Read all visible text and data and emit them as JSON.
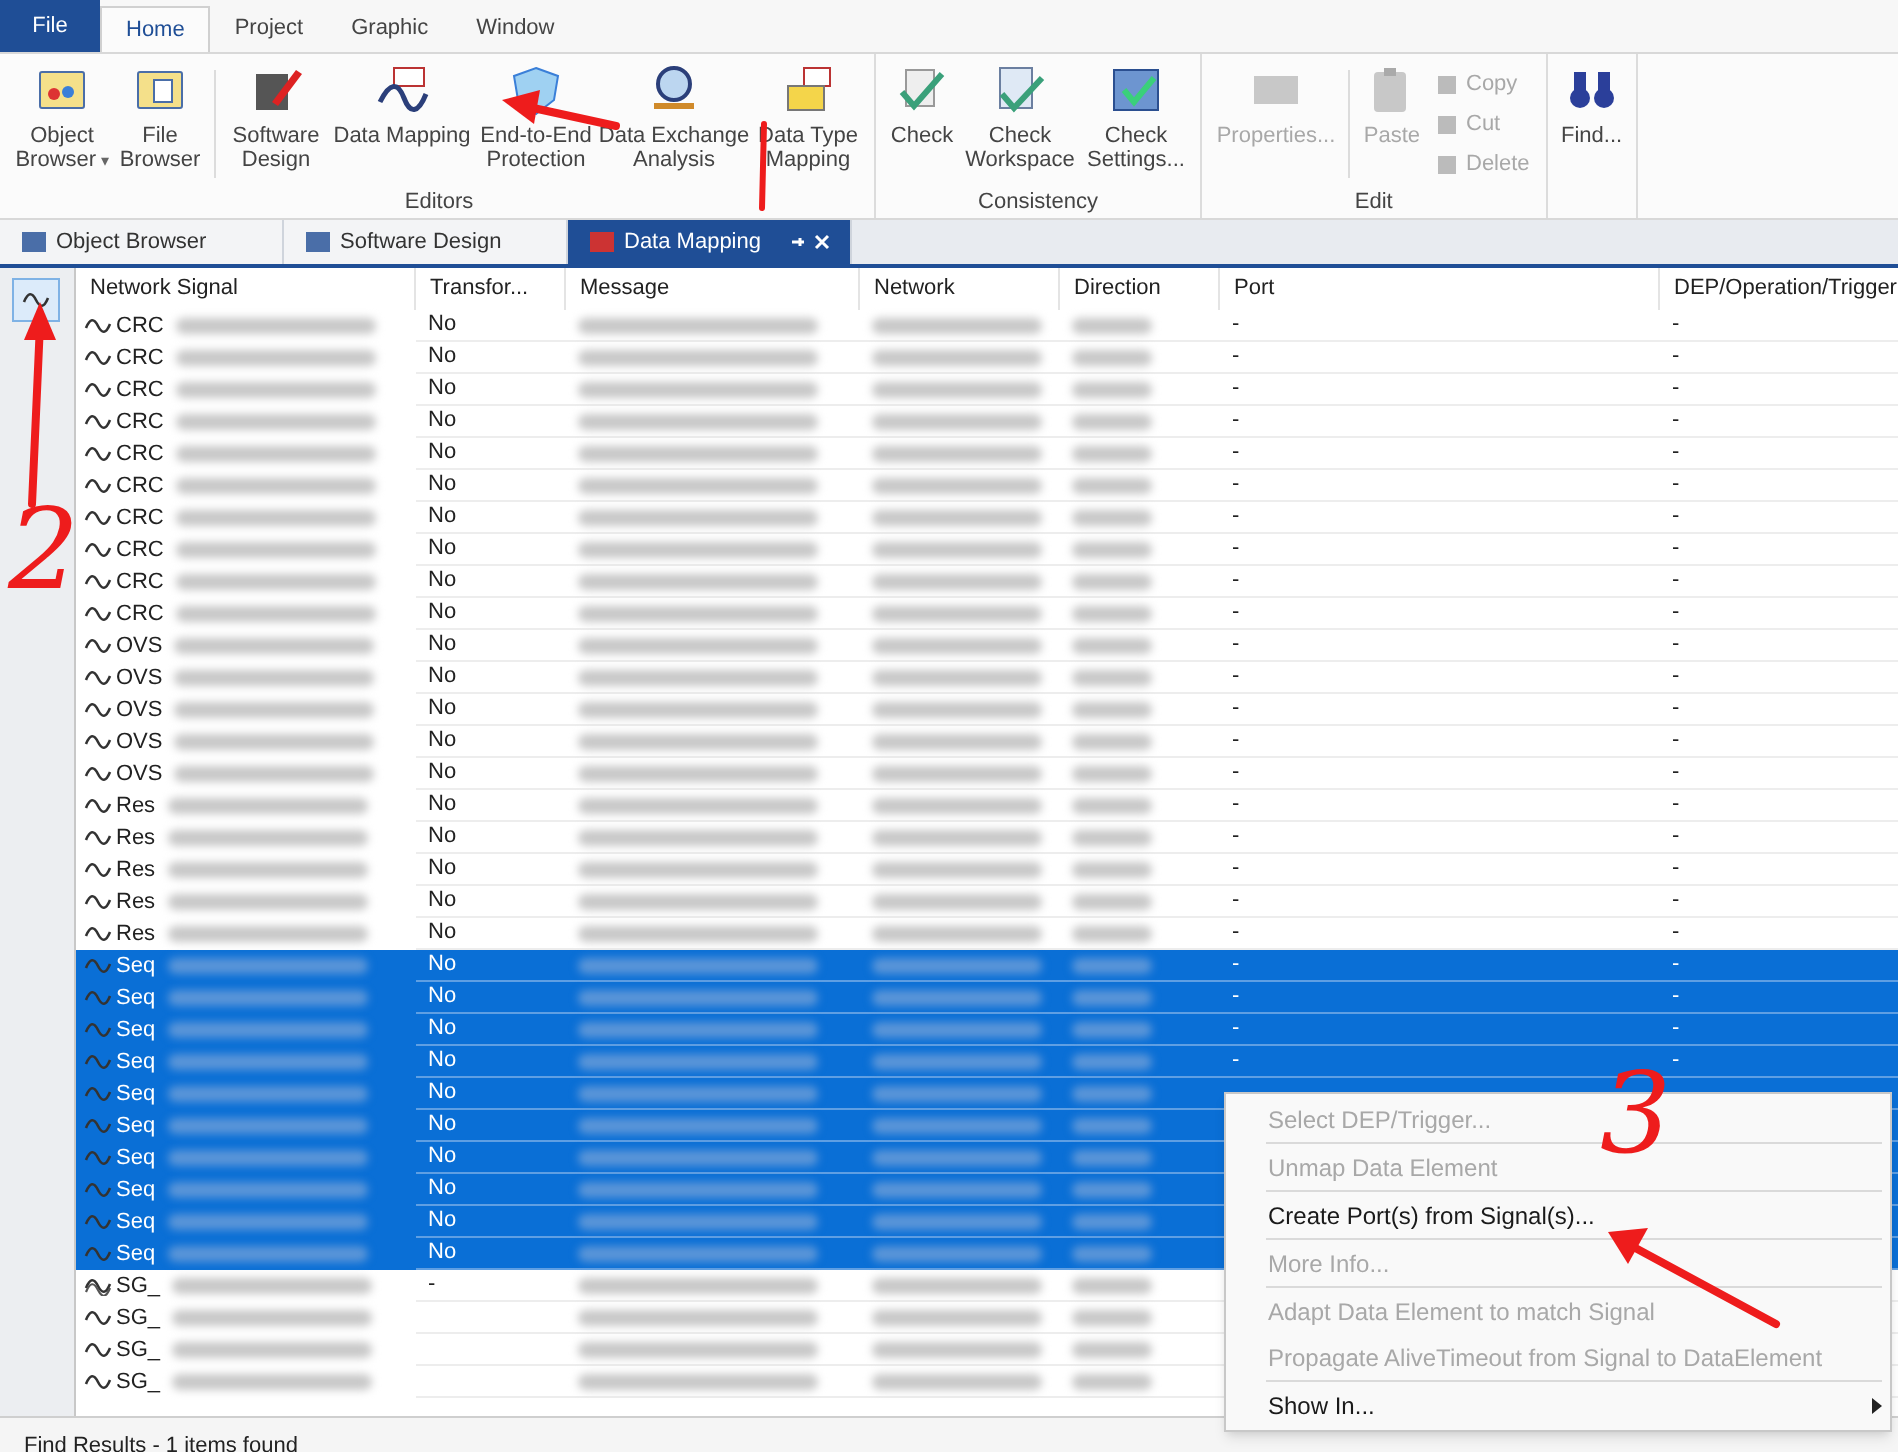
{
  "file_button": {
    "label": "File"
  },
  "ribbon_tabs": [
    {
      "label": "Home",
      "selected": true
    },
    {
      "label": "Project",
      "selected": false
    },
    {
      "label": "Graphic",
      "selected": false
    },
    {
      "label": "Window",
      "selected": false
    }
  ],
  "ribbon_groups": [
    {
      "label": "Editors",
      "items": [
        {
          "kind": "large",
          "label": "Object Browser",
          "caret": "▾",
          "disabled": false
        },
        {
          "kind": "large",
          "label": "File Browser",
          "disabled": false
        },
        {
          "kind": "separator"
        },
        {
          "kind": "large",
          "label": "Software Design",
          "disabled": false
        },
        {
          "kind": "large",
          "label": "Data Mapping",
          "disabled": false
        },
        {
          "kind": "large",
          "label": "End-to-End Protection",
          "disabled": false
        },
        {
          "kind": "large",
          "label": "Data Exchange Analysis",
          "disabled": false
        },
        {
          "kind": "large",
          "label": "Data Type Mapping",
          "disabled": false
        }
      ]
    },
    {
      "label": "Consistency",
      "items": [
        {
          "kind": "large",
          "label": "Check",
          "disabled": false
        },
        {
          "kind": "large",
          "label": "Check Workspace",
          "disabled": false
        },
        {
          "kind": "large",
          "label": "Check Settings...",
          "disabled": false
        }
      ]
    },
    {
      "label": "Edit",
      "items": [
        {
          "kind": "large",
          "label": "Properties...",
          "disabled": true
        },
        {
          "kind": "separator"
        },
        {
          "kind": "large",
          "label": "Paste",
          "disabled": true
        },
        {
          "kind": "small",
          "entries": [
            {
              "label": "Copy",
              "disabled": true
            },
            {
              "label": "Cut",
              "disabled": true
            },
            {
              "label": "Delete",
              "disabled": true
            }
          ]
        }
      ]
    },
    {
      "items": [
        {
          "kind": "large",
          "label": "Find...",
          "disabled": false
        }
      ]
    }
  ],
  "doc_tabs": [
    {
      "label": "Object Browser",
      "selected": false
    },
    {
      "label": "Software Design",
      "selected": false
    },
    {
      "label": "Data Mapping",
      "selected": true
    }
  ],
  "columns": [
    "Network Signal",
    "Transfor...",
    "Message",
    "Network",
    "Direction",
    "Port",
    "DEP/Operation/Trigger"
  ],
  "rows": [
    {
      "kind": "signal",
      "signal": "CRC",
      "transformer": "No",
      "port": "-",
      "dep": "-",
      "selected": false
    },
    {
      "kind": "signal",
      "signal": "CRC",
      "transformer": "No",
      "port": "-",
      "dep": "-",
      "selected": false
    },
    {
      "kind": "signal",
      "signal": "CRC",
      "transformer": "No",
      "port": "-",
      "dep": "-",
      "selected": false
    },
    {
      "kind": "signal",
      "signal": "CRC",
      "transformer": "No",
      "port": "-",
      "dep": "-",
      "selected": false
    },
    {
      "kind": "signal",
      "signal": "CRC",
      "transformer": "No",
      "port": "-",
      "dep": "-",
      "selected": false
    },
    {
      "kind": "signal",
      "signal": "CRC",
      "transformer": "No",
      "port": "-",
      "dep": "-",
      "selected": false
    },
    {
      "kind": "signal",
      "signal": "CRC",
      "transformer": "No",
      "port": "-",
      "dep": "-",
      "selected": false
    },
    {
      "kind": "signal",
      "signal": "CRC",
      "transformer": "No",
      "port": "-",
      "dep": "-",
      "selected": false
    },
    {
      "kind": "signal",
      "signal": "CRC",
      "transformer": "No",
      "port": "-",
      "dep": "-",
      "selected": false
    },
    {
      "kind": "signal",
      "signal": "CRC",
      "transformer": "No",
      "port": "-",
      "dep": "-",
      "selected": false
    },
    {
      "kind": "signal",
      "signal": "OVS",
      "transformer": "No",
      "port": "-",
      "dep": "-",
      "selected": false
    },
    {
      "kind": "signal",
      "signal": "OVS",
      "transformer": "No",
      "port": "-",
      "dep": "-",
      "selected": false
    },
    {
      "kind": "signal",
      "signal": "OVS",
      "transformer": "No",
      "port": "-",
      "dep": "-",
      "selected": false
    },
    {
      "kind": "signal",
      "signal": "OVS",
      "transformer": "No",
      "port": "-",
      "dep": "-",
      "selected": false
    },
    {
      "kind": "signal",
      "signal": "OVS",
      "transformer": "No",
      "port": "-",
      "dep": "-",
      "selected": false
    },
    {
      "kind": "signal",
      "signal": "Res",
      "transformer": "No",
      "port": "-",
      "dep": "-",
      "selected": false
    },
    {
      "kind": "signal",
      "signal": "Res",
      "transformer": "No",
      "port": "-",
      "dep": "-",
      "selected": false
    },
    {
      "kind": "signal",
      "signal": "Res",
      "transformer": "No",
      "port": "-",
      "dep": "-",
      "selected": false
    },
    {
      "kind": "signal",
      "signal": "Res",
      "transformer": "No",
      "port": "-",
      "dep": "-",
      "selected": false
    },
    {
      "kind": "signal",
      "signal": "Res",
      "transformer": "No",
      "port": "-",
      "dep": "-",
      "selected": false
    },
    {
      "kind": "signal",
      "signal": "Seq",
      "transformer": "No",
      "port": "-",
      "dep": "-",
      "selected": true
    },
    {
      "kind": "signal",
      "signal": "Seq",
      "transformer": "No",
      "port": "-",
      "dep": "-",
      "selected": true
    },
    {
      "kind": "signal",
      "signal": "Seq",
      "transformer": "No",
      "port": "-",
      "dep": "-",
      "selected": true
    },
    {
      "kind": "signal",
      "signal": "Seq",
      "transformer": "No",
      "port": "-",
      "dep": "-",
      "selected": true
    },
    {
      "kind": "signal",
      "signal": "Seq",
      "transformer": "No",
      "selected": true
    },
    {
      "kind": "signal",
      "signal": "Seq",
      "transformer": "No",
      "selected": true
    },
    {
      "kind": "signal",
      "signal": "Seq",
      "transformer": "No",
      "selected": true
    },
    {
      "kind": "signal",
      "signal": "Seq",
      "transformer": "No",
      "selected": true
    },
    {
      "kind": "signal",
      "signal": "Seq",
      "transformer": "No",
      "selected": true
    },
    {
      "kind": "signal",
      "signal": "Seq",
      "transformer": "No",
      "selected": true
    },
    {
      "kind": "group",
      "signal": "SG_",
      "transformer": "-",
      "selected": false
    },
    {
      "kind": "signal",
      "signal": "SG_",
      "selected": false
    },
    {
      "kind": "signal",
      "signal": "SG_",
      "selected": false
    },
    {
      "kind": "signal",
      "signal": "SG_",
      "selected": false
    }
  ],
  "context_menu": [
    {
      "label": "Select DEP/Trigger...",
      "disabled": true,
      "separator_before": false,
      "submenu": false
    },
    {
      "label": "Unmap Data Element",
      "disabled": true,
      "separator_before": true,
      "submenu": false
    },
    {
      "label": "Create Port(s) from Signal(s)...",
      "disabled": false,
      "separator_before": true,
      "submenu": false
    },
    {
      "label": "More Info...",
      "disabled": true,
      "separator_before": true,
      "submenu": false
    },
    {
      "label": "Adapt Data Element to match Signal",
      "disabled": true,
      "separator_before": true,
      "submenu": false
    },
    {
      "label": "Propagate AliveTimeout from Signal to DataElement",
      "disabled": true,
      "separator_before": false,
      "submenu": false
    },
    {
      "label": "Show In...",
      "disabled": false,
      "separator_before": true,
      "submenu": true
    }
  ],
  "status": "Find Results - 1 items found",
  "annotations": [
    {
      "kind": "arrow"
    },
    {
      "kind": "line"
    },
    {
      "kind": "arrow"
    },
    {
      "kind": "number",
      "text": "2"
    },
    {
      "kind": "number",
      "text": "3"
    },
    {
      "kind": "arrow"
    }
  ]
}
